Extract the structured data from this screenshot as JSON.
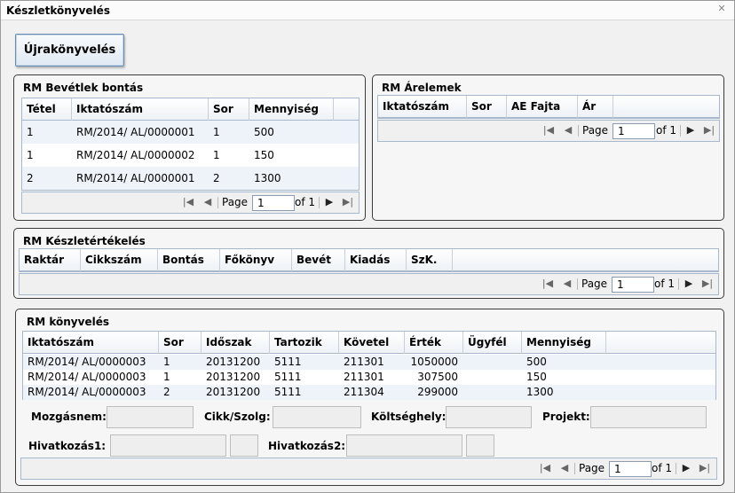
{
  "window": {
    "title": "Készletkönyvelés"
  },
  "toolbar": {
    "rebook_label": "Újrakönyvelés"
  },
  "bevetelek": {
    "title": "RM Bevétlek bontás",
    "columns": [
      "Tétel",
      "Iktatószám",
      "Sor",
      "Mennyiség"
    ],
    "rows": [
      [
        "1",
        "RM/2014/  AL/0000001",
        "1",
        "500"
      ],
      [
        "1",
        "RM/2014/  AL/0000002",
        "1",
        "150"
      ],
      [
        "2",
        "RM/2014/  AL/0000001",
        "2",
        "1300"
      ]
    ],
    "pager": {
      "page_label": "Page",
      "page_value": "1",
      "of_label": "of 1"
    }
  },
  "arelemek": {
    "title": "RM Árelemek",
    "columns": [
      "Iktatószám",
      "Sor",
      "AE Fajta",
      "Ár"
    ],
    "pager": {
      "page_label": "Page",
      "page_value": "1",
      "of_label": "of 1"
    }
  },
  "keszletertekeles": {
    "title": "RM Készletértékelés",
    "columns": [
      "Raktár",
      "Cikkszám",
      "Bontás",
      "Főkönyv",
      "Bevét",
      "Kiadás",
      "SzK."
    ],
    "pager": {
      "page_label": "Page",
      "page_value": "1",
      "of_label": "of 1"
    }
  },
  "konyveles": {
    "title": "RM könyvelés",
    "columns": [
      "Iktatószám",
      "Sor",
      "Időszak",
      "Tartozik",
      "Követel",
      "Érték",
      "Ügyfél",
      "Mennyiség"
    ],
    "rows": [
      [
        "RM/2014/  AL/0000003",
        "1",
        "20131200",
        "5111",
        "211301",
        "1050000",
        "",
        "500"
      ],
      [
        "RM/2014/  AL/0000003",
        "1",
        "20131200",
        "5111",
        "211301",
        "307500",
        "",
        "150"
      ],
      [
        "RM/2014/  AL/0000003",
        "2",
        "20131200",
        "5111",
        "211304",
        "299000",
        "",
        "1300"
      ]
    ],
    "fields": {
      "mozgasnem": "Mozgásnem:",
      "cikk": "Cikk/Szolg:",
      "koltseghely": "Költséghely:",
      "projekt": "Projekt:",
      "hivatkozas1": "Hivatkozás1:",
      "hivatkozas2": "Hivatkozás2:"
    },
    "pager": {
      "page_label": "Page",
      "page_value": "1",
      "of_label": "of 1"
    }
  },
  "icons": {
    "first": "first-page-icon",
    "prev": "prev-page-icon",
    "next": "next-page-icon",
    "last": "last-page-icon",
    "close": "close-icon"
  }
}
